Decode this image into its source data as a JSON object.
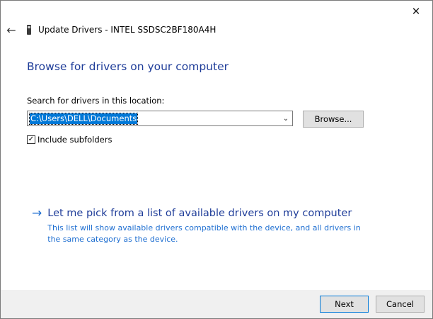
{
  "window": {
    "close_glyph": "✕",
    "back_glyph": "←",
    "title": "Update Drivers - INTEL SSDSC2BF180A4H"
  },
  "main": {
    "heading": "Browse for drivers on your computer",
    "search_label": "Search for drivers in this location:",
    "path_value": "C:\\Users\\DELL\\Documents",
    "combo_arrow": "⌄",
    "browse_label": "Browse...",
    "include_subfolders": {
      "label": "Include subfolders",
      "checked": true,
      "check_glyph": "✓"
    }
  },
  "pick": {
    "arrow_glyph": "→",
    "title": "Let me pick from a list of available drivers on my computer",
    "description": "This list will show available drivers compatible with the device, and all drivers in the same category as the device."
  },
  "footer": {
    "next_label": "Next",
    "cancel_label": "Cancel"
  },
  "colors": {
    "heading": "#1f3d99",
    "link": "#1f6fd1",
    "selection": "#0078d7",
    "footer_bg": "#f0f0f0"
  },
  "icons": {
    "close": "close-icon",
    "back": "back-arrow-icon",
    "device": "drive-icon",
    "dropdown": "chevron-down-icon",
    "checkbox": "checkmark-icon",
    "link_arrow": "arrow-right-icon"
  }
}
